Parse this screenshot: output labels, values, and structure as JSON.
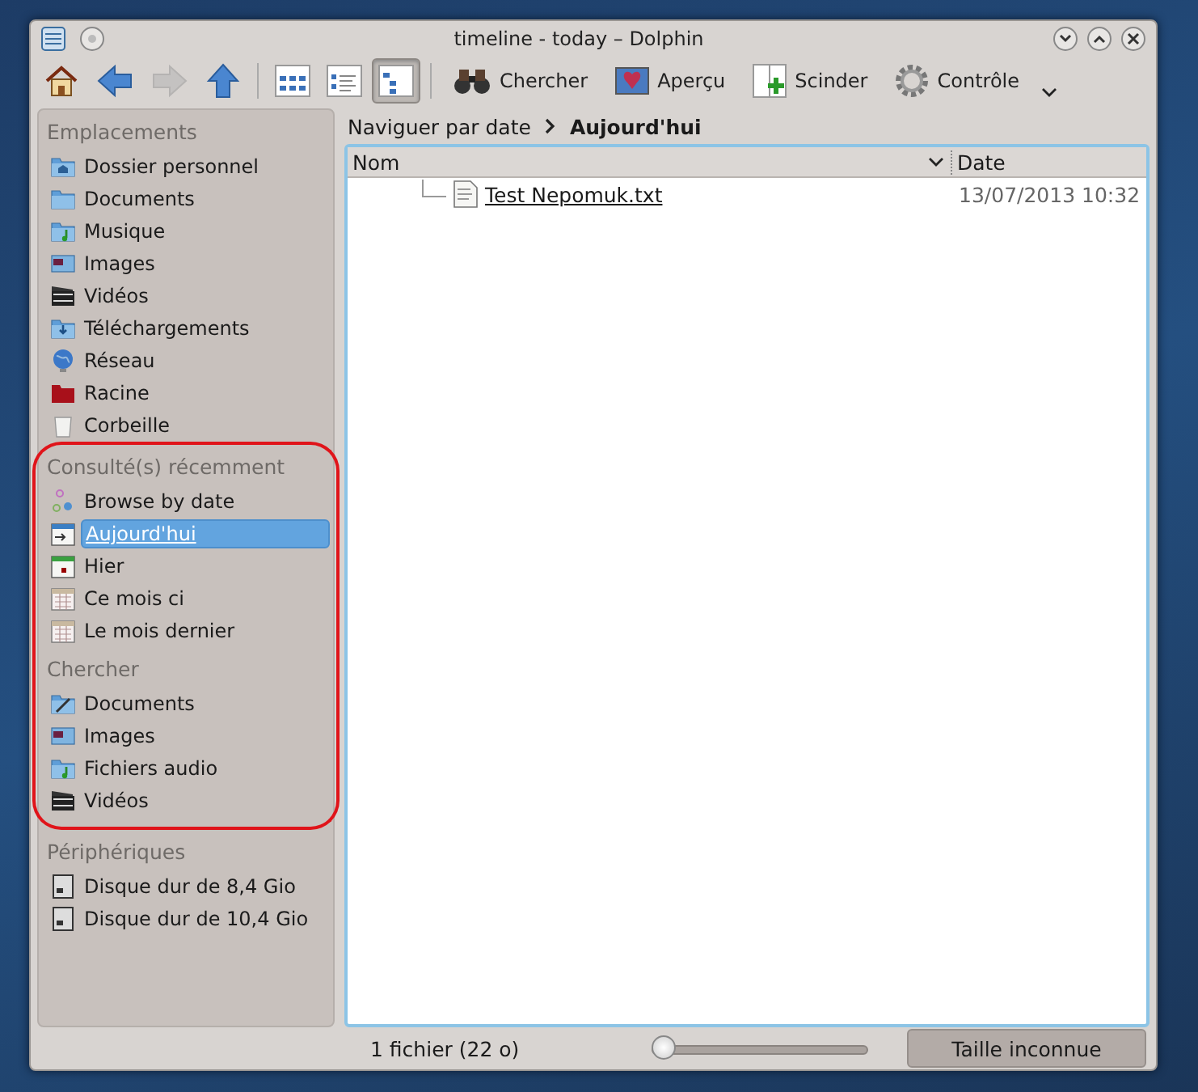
{
  "window": {
    "title": "timeline - today – Dolphin"
  },
  "toolbar": {
    "navigation": [
      {
        "kind": "home",
        "disabled": false
      },
      {
        "kind": "back",
        "disabled": false
      },
      {
        "kind": "forward",
        "disabled": true
      },
      {
        "kind": "up",
        "disabled": false
      }
    ],
    "view_modes": [
      {
        "kind": "icons",
        "selected": false
      },
      {
        "kind": "compact",
        "selected": false
      },
      {
        "kind": "details",
        "selected": true
      }
    ],
    "actions": [
      {
        "kind": "binoculars",
        "label": "Chercher"
      },
      {
        "kind": "preview",
        "label": "Aperçu"
      },
      {
        "kind": "split",
        "label": "Scinder"
      },
      {
        "kind": "gear",
        "label": "Contrôle"
      }
    ]
  },
  "sidebar": {
    "sections": [
      {
        "title": "Emplacements",
        "highlighted": false,
        "items": [
          {
            "kind": "home",
            "label": "Dossier personnel",
            "selected": false
          },
          {
            "kind": "folder",
            "label": "Documents",
            "selected": false
          },
          {
            "kind": "music",
            "label": "Musique",
            "selected": false
          },
          {
            "kind": "images",
            "label": "Images",
            "selected": false
          },
          {
            "kind": "videos",
            "label": "Vidéos",
            "selected": false
          },
          {
            "kind": "downloads",
            "label": "Téléchargements",
            "selected": false
          },
          {
            "kind": "network",
            "label": "Réseau",
            "selected": false
          },
          {
            "kind": "root",
            "label": "Racine",
            "selected": false
          },
          {
            "kind": "trash",
            "label": "Corbeille",
            "selected": false
          }
        ]
      },
      {
        "title": "Consulté(s) récemment",
        "highlighted": true,
        "items": [
          {
            "kind": "timeline",
            "label": "Browse by date",
            "selected": false
          },
          {
            "kind": "today",
            "label": "Aujourd'hui",
            "selected": true
          },
          {
            "kind": "yesterday",
            "label": "Hier",
            "selected": false
          },
          {
            "kind": "month",
            "label": "Ce mois ci",
            "selected": false
          },
          {
            "kind": "month",
            "label": "Le mois dernier",
            "selected": false
          }
        ]
      },
      {
        "title": "Chercher",
        "highlighted": true,
        "items": [
          {
            "kind": "doc-search",
            "label": "Documents",
            "selected": false
          },
          {
            "kind": "images",
            "label": "Images",
            "selected": false
          },
          {
            "kind": "music",
            "label": "Fichiers audio",
            "selected": false
          },
          {
            "kind": "videos",
            "label": "Vidéos",
            "selected": false
          }
        ]
      },
      {
        "title": "Périphériques",
        "highlighted": false,
        "items": [
          {
            "kind": "drive",
            "label": "Disque dur de 8,4 Gio",
            "selected": false
          },
          {
            "kind": "drive",
            "label": "Disque dur de 10,4 Gio",
            "selected": false
          }
        ]
      }
    ]
  },
  "breadcrumb": [
    {
      "label": "Naviguer par date",
      "current": false
    },
    {
      "label": "Aujourd'hui",
      "current": true
    }
  ],
  "table": {
    "columns": [
      {
        "label": "Nom",
        "sorted": true
      },
      {
        "label": "Date",
        "sorted": false
      }
    ],
    "rows": [
      {
        "name": "Test Nepomuk.txt",
        "date": "13/07/2013 10:32",
        "hovered": true
      }
    ]
  },
  "status_bar": {
    "text": "1 fichier (22 o)",
    "zoom": {
      "level": 0.03
    },
    "free_space": "Taille inconnue"
  }
}
